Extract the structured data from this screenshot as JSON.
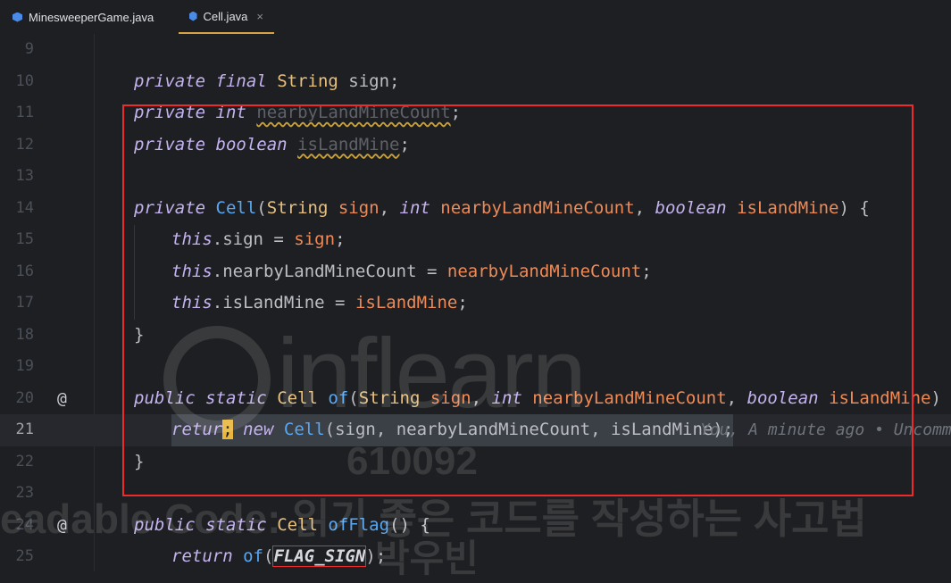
{
  "tabs": [
    {
      "label": "MinesweeperGame.java",
      "icon": "java-class-icon",
      "active": false
    },
    {
      "label": "Cell.java",
      "icon": "java-class-icon",
      "active": true,
      "close": "×"
    }
  ],
  "lines": [
    {
      "num": "9"
    },
    {
      "num": "10"
    },
    {
      "num": "11"
    },
    {
      "num": "12"
    },
    {
      "num": "13"
    },
    {
      "num": "14"
    },
    {
      "num": "15"
    },
    {
      "num": "16"
    },
    {
      "num": "17"
    },
    {
      "num": "18"
    },
    {
      "num": "19"
    },
    {
      "num": "20",
      "gutter": "@"
    },
    {
      "num": "21"
    },
    {
      "num": "22"
    },
    {
      "num": "23"
    },
    {
      "num": "24",
      "gutter": "@"
    },
    {
      "num": "25"
    }
  ],
  "code": {
    "l10": {
      "kw1": "private",
      "kw2": "final",
      "type": "String",
      "name": "sign",
      "end": ";"
    },
    "l11": {
      "kw1": "private",
      "kw2": "int",
      "name": "nearbyLandMineCount",
      "end": ";"
    },
    "l12": {
      "kw1": "private",
      "kw2": "boolean",
      "name": "isLandMine",
      "end": ";"
    },
    "l14": {
      "kw": "private",
      "fn": "Cell",
      "open": "(",
      "t1": "String",
      "p1": "sign",
      "c1": ",",
      "t2": "int",
      "p2": "nearbyLandMineCount",
      "c2": ",",
      "t3": "boolean",
      "p3": "isLandMine",
      "close": ") {"
    },
    "l15": {
      "this": "this",
      "field": ".sign",
      "eq": " = ",
      "val": "sign",
      "end": ";"
    },
    "l16": {
      "this": "this",
      "field": ".nearbyLandMineCount",
      "eq": " = ",
      "val": "nearbyLandMineCount",
      "end": ";"
    },
    "l17": {
      "this": "this",
      "field": ".isLandMine",
      "eq": " = ",
      "val": "isLandMine",
      "end": ";"
    },
    "l18": {
      "brace": "}"
    },
    "l20": {
      "kw1": "public",
      "kw2": "static",
      "type": "Cell",
      "fn": "of",
      "open": "(",
      "t1": "String",
      "p1": "sign",
      "c1": ",",
      "t2": "int",
      "p2": "nearbyLandMineCount",
      "c2": ",",
      "t3": "boolean",
      "p3": "isLandMine",
      "close": ") {"
    },
    "l21": {
      "ret": "retur",
      "caret": ";",
      "kw": "new",
      "fn": "Cell",
      "args": "(sign, nearbyLandMineCount, isLandMine);",
      "hint": "You, A minute ago • Uncommi"
    },
    "l22": {
      "brace": "}"
    },
    "l24": {
      "kw1": "public",
      "kw2": "static",
      "type": "Cell",
      "fn": "ofFlag",
      "rest": "() {"
    },
    "l25": {
      "ret": "return",
      "fn": "of",
      "open": "(",
      "const": "FLAG_SIGN",
      "close": ");"
    }
  },
  "watermark": {
    "brand": "inflearn",
    "code": "610092",
    "course": "eadable Code: 읽기 좋은 코드를 작성하는 사고법",
    "author": "박우빈"
  },
  "colors": {
    "background": "#1e1f22",
    "keyword": "#c5b3f0",
    "type": "#e8c07d",
    "function": "#56a8f5",
    "parameter": "#ef8a56",
    "field": "#c77dbb",
    "highlight_box": "#ef2a2a",
    "tab_active_underline": "#d9a343"
  }
}
